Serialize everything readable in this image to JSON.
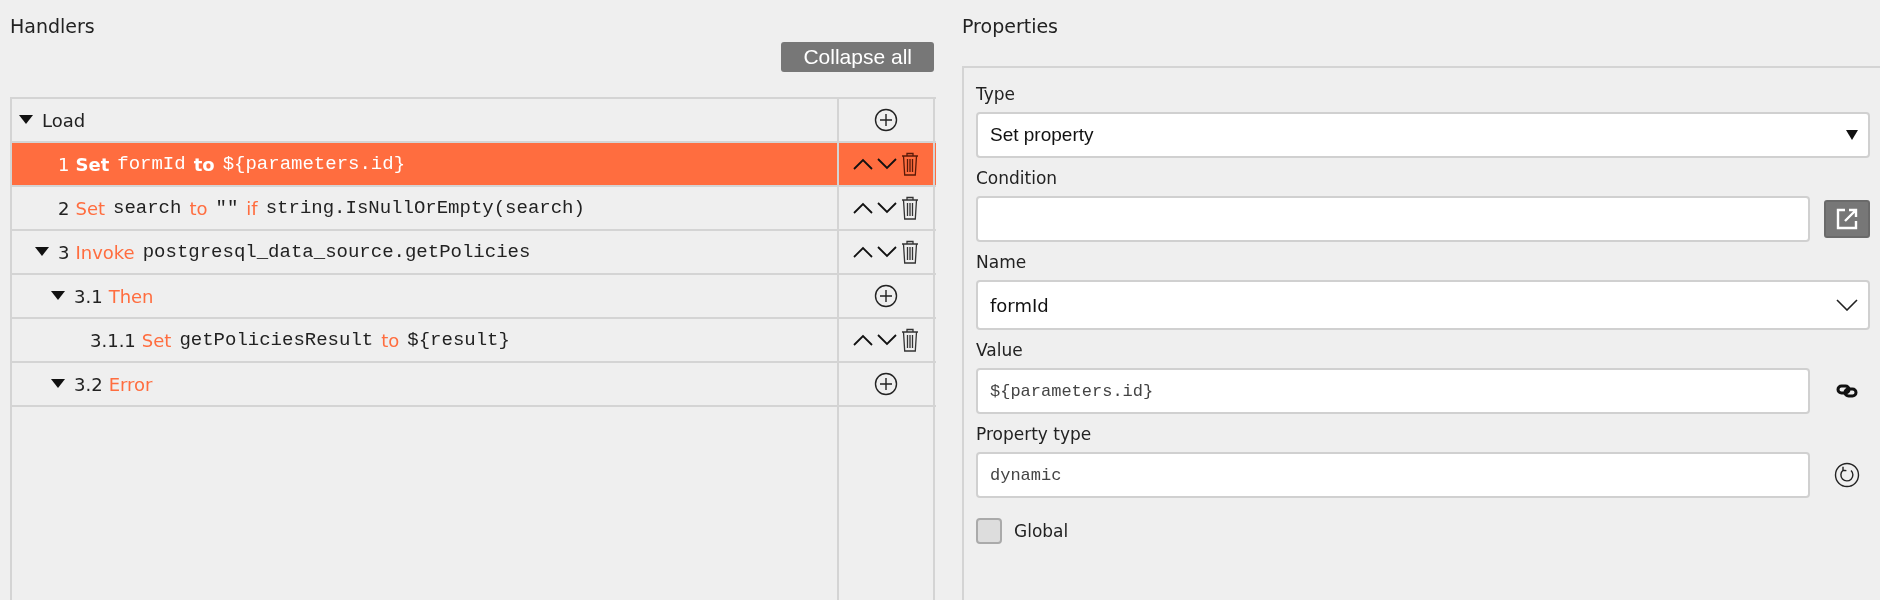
{
  "handlers": {
    "title": "Handlers",
    "collapse_button": "Collapse all",
    "tree": [
      {
        "kind": "group",
        "expanded": true,
        "selected": false,
        "segments": [
          {
            "kind": "label",
            "text": "Load"
          }
        ],
        "children": [
          {
            "kind": "statement",
            "number": "1",
            "selected": true,
            "segments": [
              {
                "kind": "keyword",
                "text": "Set"
              },
              {
                "kind": "code",
                "text": "formId"
              },
              {
                "kind": "keyword",
                "text": "to"
              },
              {
                "kind": "code",
                "text": "${parameters.id}"
              }
            ]
          },
          {
            "kind": "statement",
            "number": "2",
            "selected": false,
            "segments": [
              {
                "kind": "keyword",
                "text": "Set"
              },
              {
                "kind": "code",
                "text": "search"
              },
              {
                "kind": "keyword",
                "text": "to"
              },
              {
                "kind": "code",
                "text": "\"\""
              },
              {
                "kind": "keyword",
                "text": "if"
              },
              {
                "kind": "code",
                "text": "string.IsNullOrEmpty(search)"
              }
            ]
          },
          {
            "kind": "statement",
            "number": "3",
            "expanded": true,
            "selected": false,
            "segments": [
              {
                "kind": "keyword",
                "text": "Invoke"
              },
              {
                "kind": "code",
                "text": "postgresql_data_source.getPolicies"
              }
            ],
            "children": [
              {
                "kind": "group",
                "number": "3.1",
                "expanded": true,
                "selected": false,
                "segments": [
                  {
                    "kind": "keyword",
                    "text": "Then"
                  }
                ],
                "children": [
                  {
                    "kind": "statement",
                    "number": "3.1.1",
                    "selected": false,
                    "segments": [
                      {
                        "kind": "keyword",
                        "text": "Set"
                      },
                      {
                        "kind": "code",
                        "text": "getPoliciesResult"
                      },
                      {
                        "kind": "keyword",
                        "text": "to"
                      },
                      {
                        "kind": "code",
                        "text": "${result}"
                      }
                    ]
                  }
                ]
              },
              {
                "kind": "group",
                "number": "3.2",
                "expanded": true,
                "selected": false,
                "segments": [
                  {
                    "kind": "keyword",
                    "text": "Error"
                  }
                ]
              }
            ]
          }
        ]
      }
    ]
  },
  "properties": {
    "title": "Properties",
    "type": {
      "label": "Type",
      "value": "Set property"
    },
    "condition": {
      "label": "Condition"
    },
    "name": {
      "label": "Name",
      "value": "formId"
    },
    "value": {
      "label": "Value",
      "value": "${parameters.id}"
    },
    "property_type": {
      "label": "Property type",
      "value": "dynamic"
    },
    "global": {
      "label": "Global",
      "checked": false
    }
  }
}
